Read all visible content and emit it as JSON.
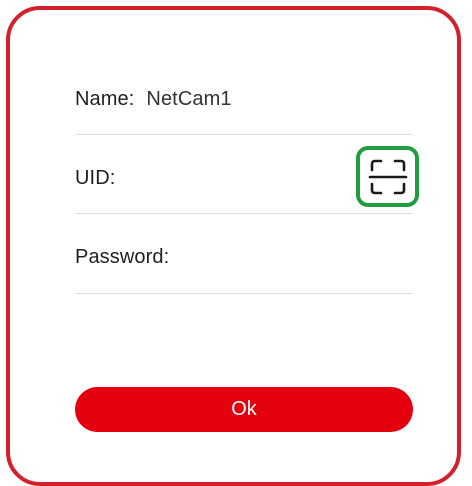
{
  "dialog": {
    "name_label": "Name:",
    "name_value": "NetCam1",
    "uid_label": "UID:",
    "uid_value": "",
    "password_label": "Password:",
    "password_value": "",
    "scan_icon": "qr-scan-icon",
    "ok_label": "Ok"
  },
  "colors": {
    "frame_border": "#d4202c",
    "button_bg": "#e3000f",
    "scan_highlight": "#1f9d3f"
  }
}
